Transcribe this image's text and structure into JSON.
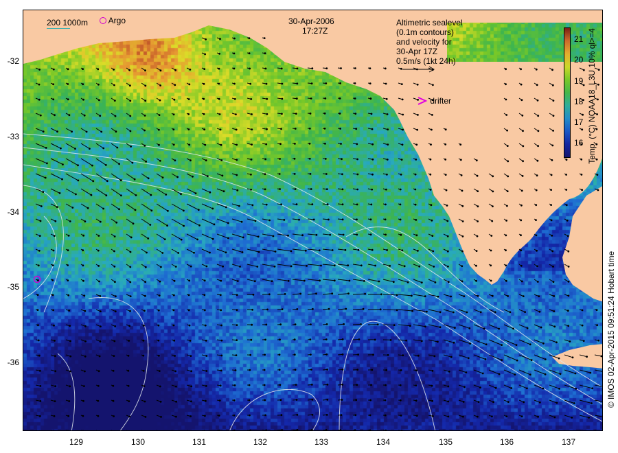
{
  "header": {
    "date": "30-Apr-2006",
    "time": "17:27Z"
  },
  "legend": {
    "depth_label": "200 1000m",
    "argo_label": "Argo",
    "drifter_label": "drifter",
    "altimetry_lines": [
      "Altimetric sealevel",
      "(0.1m contours)",
      "and velocity for",
      "30-Apr 17Z",
      "0.5m/s (1kt 24h)"
    ]
  },
  "colorbar": {
    "label": "Temp. (°C) NOAA18_L3U 10% ql>=4",
    "ticks": [
      "21",
      "20",
      "19",
      "18",
      "17",
      "16"
    ],
    "min": 15.4,
    "max": 21.6
  },
  "axes": {
    "lat_labels": [
      "-32",
      "-33",
      "-34",
      "-35",
      "-36"
    ],
    "lon_labels": [
      "129",
      "130",
      "131",
      "132",
      "133",
      "134",
      "135",
      "136",
      "137"
    ],
    "lat_range": [
      -36.9,
      -31.35
    ],
    "lon_range": [
      128.15,
      137.5
    ]
  },
  "credit": "© IMOS 02-Apr-2015 09:51:24 Hobart time",
  "colors": {
    "land": "#f9c9a3",
    "argo_marker": "#d000d0",
    "drifter_marker": "#e000e0",
    "depth_line": "#40b0b0"
  }
}
